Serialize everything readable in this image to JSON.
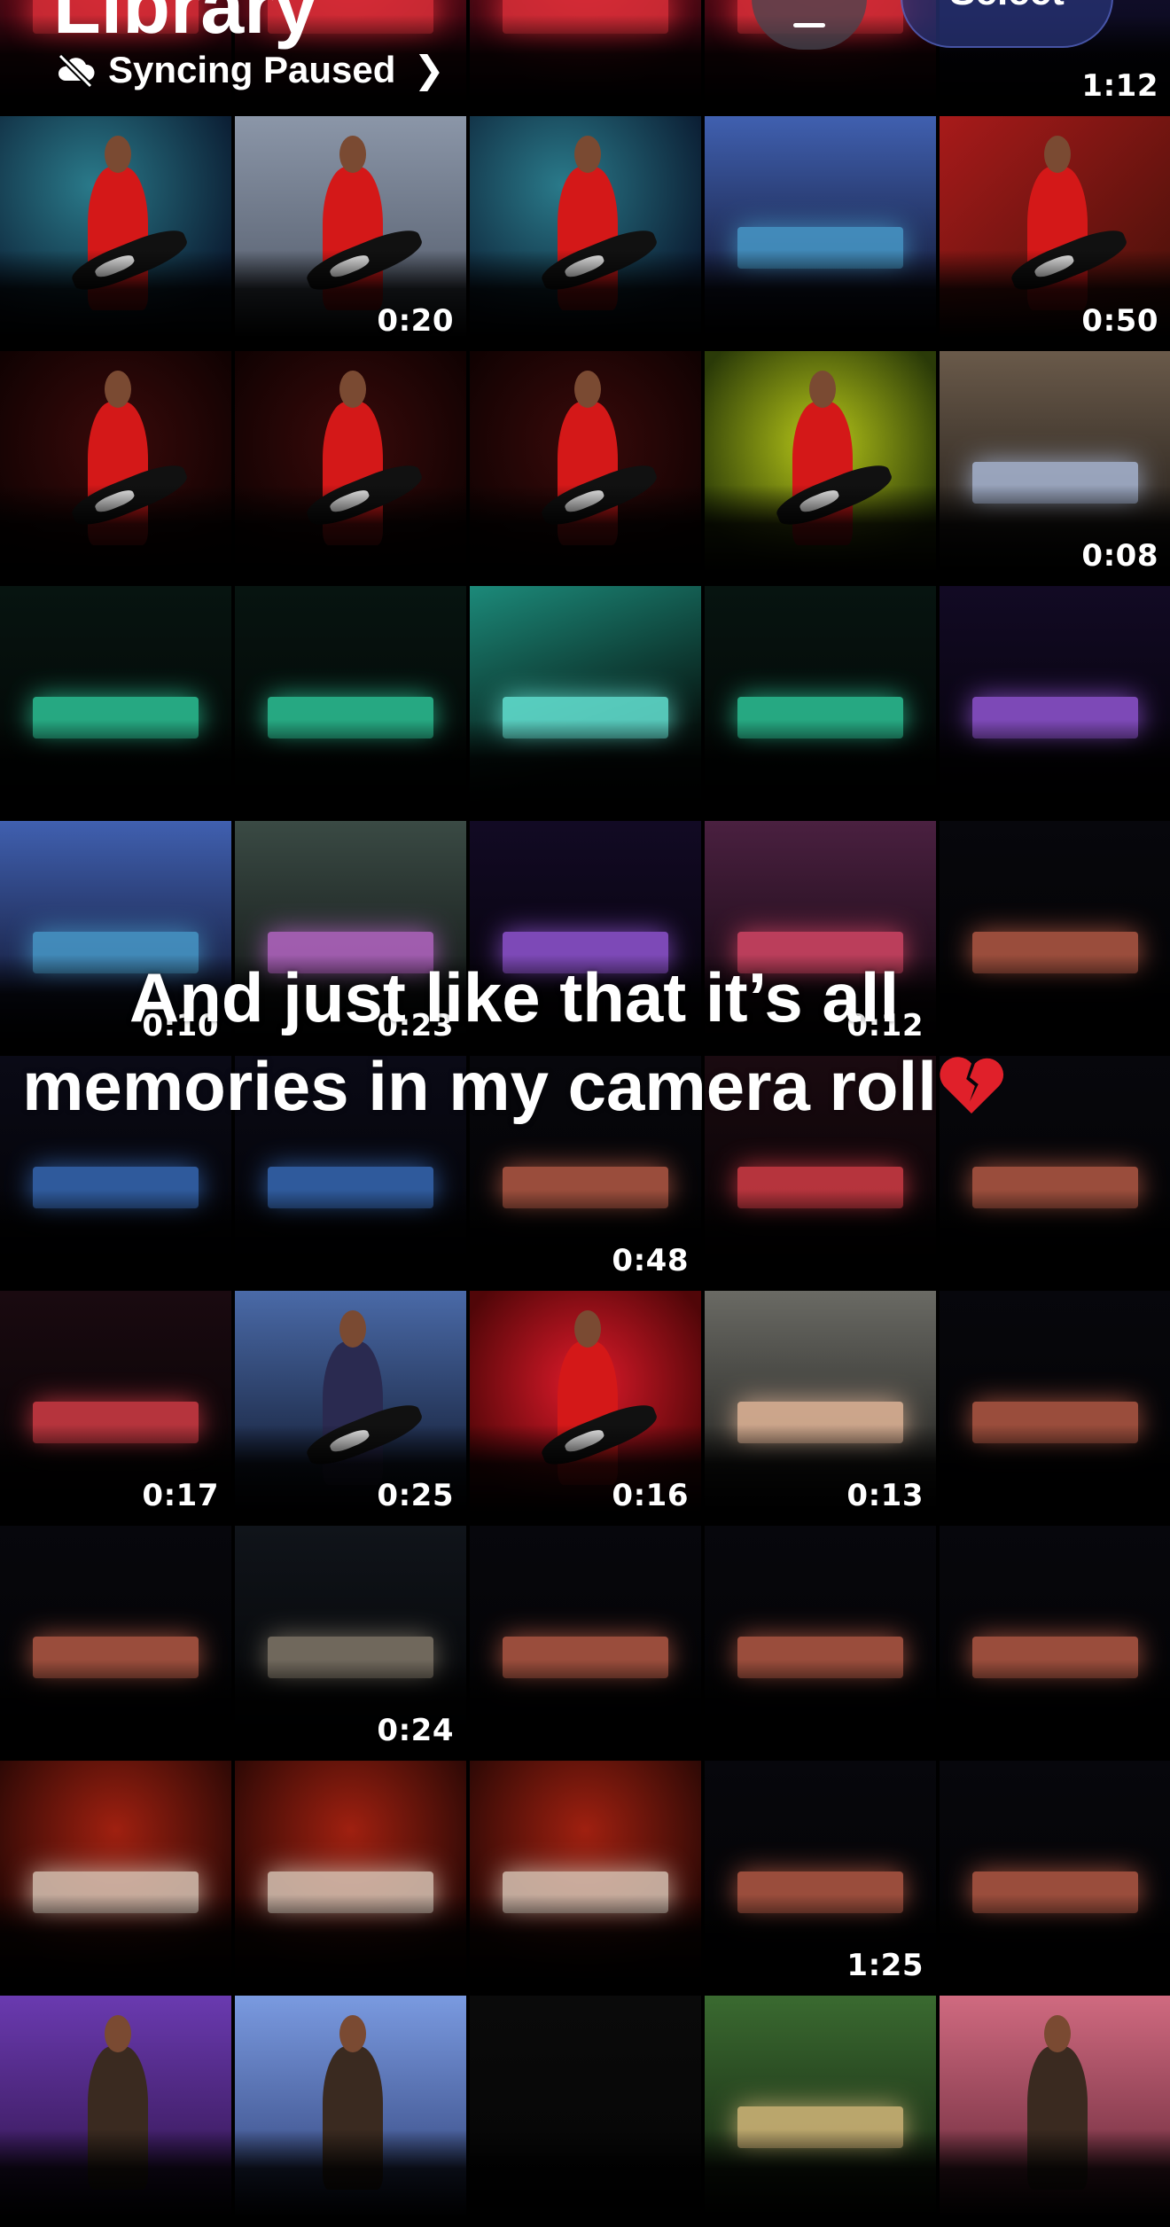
{
  "header": {
    "title": "Library",
    "sync_status": "Syncing Paused",
    "select_label": "Select",
    "icons": {
      "sync": "cloud-slash-icon",
      "chevron": "chevron-right-icon",
      "menu": "menu-icon"
    }
  },
  "caption": {
    "line1": "And just like that it’s all",
    "line2": "memories in my camera roll"
  },
  "grid": {
    "tiles": [
      {
        "scene": "stage-red",
        "duration": ""
      },
      {
        "scene": "stage-red",
        "duration": ""
      },
      {
        "scene": "stage-red",
        "duration": ""
      },
      {
        "scene": "stage-red",
        "duration": ""
      },
      {
        "scene": "dark-blue",
        "duration": "1:12"
      },
      {
        "scene": "performer-blue",
        "duration": ""
      },
      {
        "scene": "performer-grey",
        "duration": "0:20"
      },
      {
        "scene": "performer-blue",
        "duration": ""
      },
      {
        "scene": "stage-blue",
        "duration": ""
      },
      {
        "scene": "guitar-closeup",
        "duration": "0:50"
      },
      {
        "scene": "performer-red",
        "duration": ""
      },
      {
        "scene": "performer-red",
        "duration": ""
      },
      {
        "scene": "performer-red",
        "duration": ""
      },
      {
        "scene": "performer-green",
        "duration": ""
      },
      {
        "scene": "arena-wide",
        "duration": "0:08"
      },
      {
        "scene": "stage-teal",
        "duration": ""
      },
      {
        "scene": "stage-teal",
        "duration": ""
      },
      {
        "scene": "lasers-teal",
        "duration": ""
      },
      {
        "scene": "stage-teal",
        "duration": ""
      },
      {
        "scene": "stage-purple",
        "duration": ""
      },
      {
        "scene": "stage-blue",
        "duration": "0:10"
      },
      {
        "scene": "smoke-stage",
        "duration": "0:23"
      },
      {
        "scene": "stage-purple",
        "duration": ""
      },
      {
        "scene": "stage-pink",
        "duration": "0:12"
      },
      {
        "scene": "stage-dark",
        "duration": ""
      },
      {
        "scene": "stage-gold",
        "duration": ""
      },
      {
        "scene": "stage-gold",
        "duration": ""
      },
      {
        "scene": "stage-dark",
        "duration": "0:48"
      },
      {
        "scene": "stage-redscreen",
        "duration": ""
      },
      {
        "scene": "stage-dark",
        "duration": ""
      },
      {
        "scene": "stage-redscreen",
        "duration": "0:17"
      },
      {
        "scene": "performer-sparkle",
        "duration": "0:25"
      },
      {
        "scene": "red-lights",
        "duration": "0:16"
      },
      {
        "scene": "grey-crowd",
        "duration": "0:13"
      },
      {
        "scene": "stage-dark",
        "duration": ""
      },
      {
        "scene": "stage-dark",
        "duration": ""
      },
      {
        "scene": "stage-dim",
        "duration": "0:24"
      },
      {
        "scene": "stage-dark",
        "duration": ""
      },
      {
        "scene": "stage-dark",
        "duration": ""
      },
      {
        "scene": "stage-dark",
        "duration": ""
      },
      {
        "scene": "fire-stage",
        "duration": ""
      },
      {
        "scene": "fire-stage",
        "duration": ""
      },
      {
        "scene": "fire-stage",
        "duration": ""
      },
      {
        "scene": "stage-dark",
        "duration": "1:25"
      },
      {
        "scene": "stage-dark",
        "duration": ""
      },
      {
        "scene": "portrait-purple",
        "duration": ""
      },
      {
        "scene": "portrait-blue",
        "duration": ""
      },
      {
        "scene": "dark",
        "duration": ""
      },
      {
        "scene": "stage-green",
        "duration": ""
      },
      {
        "scene": "portrait-pink",
        "duration": ""
      }
    ]
  }
}
